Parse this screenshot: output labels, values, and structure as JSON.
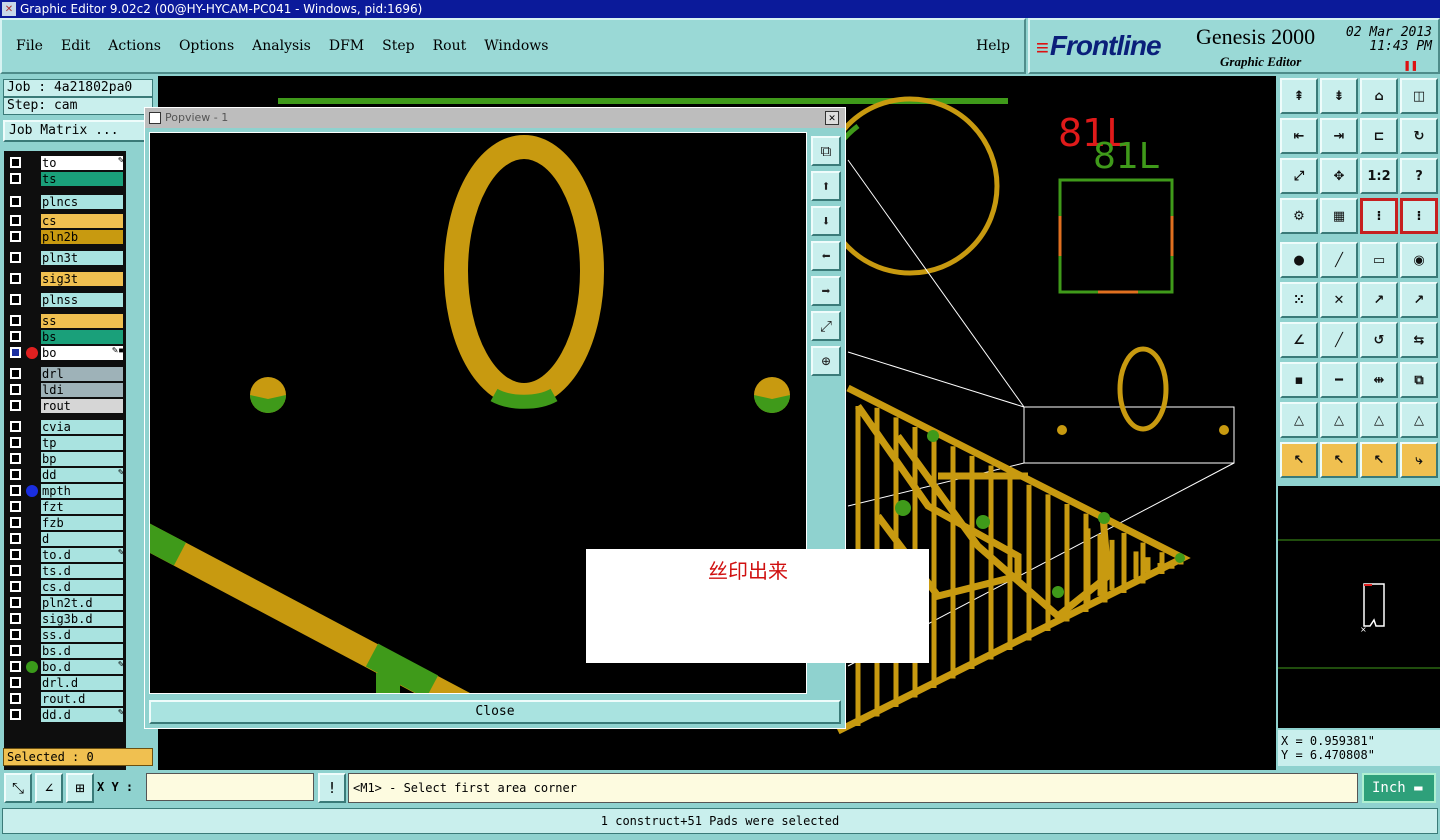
{
  "window": {
    "title": "Graphic Editor 9.02c2 (00@HY-HYCAM-PC041 - Windows, pid:1696)"
  },
  "menu": {
    "items": [
      "File",
      "Edit",
      "Actions",
      "Options",
      "Analysis",
      "DFM",
      "Step",
      "Rout",
      "Windows"
    ],
    "help": "Help"
  },
  "brand": {
    "logo": "Frontline",
    "product": "Genesis 2000",
    "subtitle": "Graphic Editor",
    "date": "02 Mar 2013",
    "time": "11:43 PM"
  },
  "job": {
    "job_label": "Job : 4a21802pa0",
    "step_label": "Step: cam",
    "matrix_button": "Job Matrix ..."
  },
  "layers": [
    {
      "name": "to",
      "color": "#ffffff",
      "mark": "hand"
    },
    {
      "name": "ts",
      "color": "#1aa07a"
    },
    {
      "name": "plncs",
      "color": "#a9e3e0"
    },
    {
      "name": "cs",
      "color": "#f0c050"
    },
    {
      "name": "pln2b",
      "color": "#c89a10"
    },
    {
      "name": "pln3t",
      "color": "#a9e3e0"
    },
    {
      "name": "sig3t",
      "color": "#f0c050"
    },
    {
      "name": "plnss",
      "color": "#a9e3e0"
    },
    {
      "name": "ss",
      "color": "#f0c050"
    },
    {
      "name": "bs",
      "color": "#1aa07a"
    },
    {
      "name": "bo",
      "color": "#ffffff",
      "mark": "hand-edit",
      "dot": "#e02020",
      "active": true
    },
    {
      "name": "drl",
      "color": "#9eb2b8"
    },
    {
      "name": "ldi",
      "color": "#9eb2b8"
    },
    {
      "name": "rout",
      "color": "#d6d6d6"
    },
    {
      "name": "cvia",
      "color": "#a9e3e0"
    },
    {
      "name": "tp",
      "color": "#a9e3e0"
    },
    {
      "name": "bp",
      "color": "#a9e3e0"
    },
    {
      "name": "dd",
      "color": "#a9e3e0",
      "mark": "hand"
    },
    {
      "name": "mpth",
      "color": "#a9e3e0",
      "dot": "#1a2ee0"
    },
    {
      "name": "fzt",
      "color": "#a9e3e0"
    },
    {
      "name": "fzb",
      "color": "#a9e3e0"
    },
    {
      "name": "d",
      "color": "#a9e3e0"
    },
    {
      "name": "to.d",
      "color": "#a9e3e0",
      "mark": "hand"
    },
    {
      "name": "ts.d",
      "color": "#a9e3e0"
    },
    {
      "name": "cs.d",
      "color": "#a9e3e0"
    },
    {
      "name": "pln2t.d",
      "color": "#a9e3e0"
    },
    {
      "name": "sig3b.d",
      "color": "#a9e3e0"
    },
    {
      "name": "ss.d",
      "color": "#a9e3e0"
    },
    {
      "name": "bs.d",
      "color": "#a9e3e0"
    },
    {
      "name": "bo.d",
      "color": "#a9e3e0",
      "mark": "hand",
      "dot": "#3a9a1a"
    },
    {
      "name": "drl.d",
      "color": "#a9e3e0"
    },
    {
      "name": "rout.d",
      "color": "#a9e3e0"
    },
    {
      "name": "dd.d",
      "color": "#a9e3e0",
      "mark": "hand"
    }
  ],
  "selected": "Selected : 0",
  "popview": {
    "title": "Popview - 1",
    "close_button": "Close"
  },
  "annotation": {
    "text": "丝印出来"
  },
  "canvas_text": {
    "red_label": "81L",
    "green_label": "81L"
  },
  "toolbox": {
    "buttons": [
      "1:2",
      "?"
    ]
  },
  "coords": {
    "x": "X = 0.959381\"",
    "y": "Y = 6.470808\""
  },
  "status": {
    "xy_label": "X Y :",
    "xy_value": "",
    "prompt": "<M1> - Select first area corner",
    "unit": "Inch",
    "message": "1 construct+51 Pads were selected"
  }
}
